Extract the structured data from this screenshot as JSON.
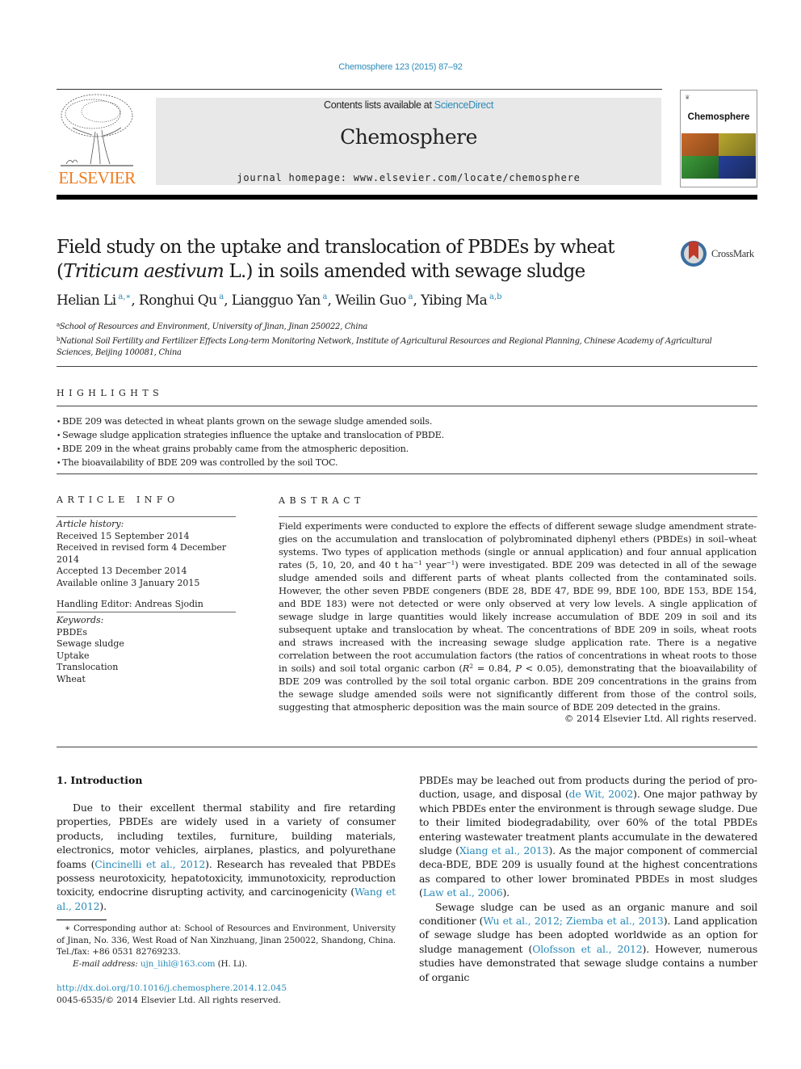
{
  "header": {
    "citation": "Chemosphere 123 (2015) 87–92",
    "publisher_logo_text": "ELSEVIER",
    "contents_prefix": "Contents lists available at ",
    "contents_link": "ScienceDirect",
    "journal_name": "Chemosphere",
    "homepage_prefix": "journal homepage: ",
    "homepage_url": "www.elsevier.com/locate/chemosphere",
    "cover_title": "Chemosphere",
    "cover_mini_logo": "❦"
  },
  "article": {
    "title_part1": "Field study on the uptake and translocation of PBDEs by wheat (",
    "title_italic1": "Triticum aestivum",
    "title_part2": " L.) in soils amended with sewage sludge",
    "crossmark_label": "CrossMark",
    "authors": [
      {
        "name": "Helian Li",
        "sup": "a,∗",
        "sep": ", "
      },
      {
        "name": "Ronghui Qu",
        "sup": "a",
        "sep": ", "
      },
      {
        "name": "Liangguo Yan",
        "sup": "a",
        "sep": ", "
      },
      {
        "name": "Weilin Guo",
        "sup": "a",
        "sep": ", "
      },
      {
        "name": "Yibing Ma",
        "sup": "a,b",
        "sep": ""
      }
    ],
    "affiliations": [
      {
        "mark": "a",
        "text": "School of Resources and Environment, University of Jinan, Jinan 250022, China"
      },
      {
        "mark": "b",
        "text": "National Soil Fertility and Fertilizer Effects Long-term Monitoring Network, Institute of Agricultural Resources and Regional Planning, Chinese Academy of Agricultural Sciences, Beijing 100081, China"
      }
    ]
  },
  "highlights": {
    "heading": "HIGHLIGHTS",
    "items": [
      "BDE 209 was detected in wheat plants grown on the sewage sludge amended soils.",
      "Sewage sludge application strategies influence the uptake and translocation of PBDE.",
      "BDE 209 in the wheat grains probably came from the atmospheric deposition.",
      "The bioavailability of BDE 209 was controlled by the soil TOC."
    ]
  },
  "article_info": {
    "heading": "ARTICLE INFO",
    "history_label": "Article history:",
    "history": [
      "Received 15 September 2014",
      "Received in revised form 4 December 2014",
      "Accepted 13 December 2014",
      "Available online 3 January 2015"
    ],
    "handling_editor": "Handling Editor: Andreas Sjodin",
    "keywords_label": "Keywords:",
    "keywords": [
      "PBDEs",
      "Sewage sludge",
      "Uptake",
      "Translocation",
      "Wheat"
    ]
  },
  "abstract": {
    "heading": "ABSTRACT",
    "text_1": "Field experiments were conducted to explore the effects of different sewage sludge amendment strate­gies on the accumulation and translocation of polybrominated diphenyl ethers (PBDEs) in soil–wheat sys­tems. Two types of application methods (single or annual application) and four annual application rates (5, 10, 20, and 40 t ha",
    "sup_1": "−1",
    "text_2": " year",
    "sup_2": "−1",
    "text_3": ") were investigated. BDE 209 was detected in all of the sewage sludge amended soils and different parts of wheat plants collected from the contaminated soils. However, the other seven PBDE congeners (BDE 28, BDE 47, BDE 99, BDE 100, BDE 153, BDE 154, and BDE 183) were not detected or were only observed at very low levels. A single application of sewage sludge in large quantities would likely increase accumulation of BDE 209 in soil and its subsequent uptake and translo­cation by wheat. The concentrations of BDE 209 in soils, wheat roots and straws increased with the increasing sewage sludge application rate. There is a negative correlation between the root accumulation factors (the ratios of concentrations in wheat roots to those in soils) and soil total organic carbon (",
    "r_symbol": "R",
    "r_sup": "2",
    "text_4": " = 0.84, ",
    "p_symbol": "P",
    "text_5": " < 0.05), demonstrating that the bioavailability of BDE 209 was controlled by the soil total organic carbon. BDE 209 concentrations in the grains from the sewage sludge amended soils were not significantly different from those of the control soils, suggesting that atmospheric deposition was the main source of BDE 209 detected in the grains.",
    "copyright": "© 2014 Elsevier Ltd. All rights reserved."
  },
  "introduction": {
    "heading": "1. Introduction",
    "left_p1": [
      {
        "t": "Due to their excellent thermal stability and fire retarding proper­ties, PBDEs are widely used in a variety of consumer products, including textiles, furniture, building materials, electronics, motor vehicles, airplanes, plastics, and polyurethane foams ("
      },
      {
        "link": "Cincinelli et al., 2012"
      },
      {
        "t": "). Research has revealed that PBDEs possess neurotox­icity, hepatotoxicity, immunotoxicity, reproduction toxicity, endo­crine disrupting activity, and carcinogenicity ("
      },
      {
        "link": "Wang et al., 2012"
      },
      {
        "t": ")."
      }
    ],
    "right_p1": [
      {
        "t": "PBDEs may be leached out from products during the period of pro­duction, usage, and disposal ("
      },
      {
        "link": "de Wit, 2002"
      },
      {
        "t": "). One major pathway by which PBDEs enter the environment is through sewage sludge. Due to their limited biodegradability, over 60% of the total PBDEs entering wastewater treatment plants accumulate in the dewatered sludge ("
      },
      {
        "link": "Xiang et al., 2013"
      },
      {
        "t": "). As the major component of commercial deca-BDE, BDE 209 is usually found at the highest concentrations as compared to other lower brominated PBDEs in most sludges ("
      },
      {
        "link": "Law et al., 2006"
      },
      {
        "t": ")."
      }
    ],
    "right_p2": [
      {
        "t": "Sewage sludge can be used as an organic manure and soil condi­tioner ("
      },
      {
        "link": "Wu et al., 2012; Ziemba et al., 2013"
      },
      {
        "t": "). Land application of sew­age sludge has been adopted worldwide as an option for sludge management ("
      },
      {
        "link": "Olofsson et al., 2012"
      },
      {
        "t": "). However, numerous studies have demonstrated that sewage sludge contains a number of organic"
      }
    ]
  },
  "footnote": {
    "star": "∗",
    "text": " Corresponding author at: School of Resources and Environment, University of Jinan, No. 336, West Road of Nan Xinzhuang, Jinan 250022, Shandong, China. Tel./fax: +86 0531 82769233.",
    "email_label": "E-mail address: ",
    "email": "ujn_lihl@163.com",
    "email_suffix": " (H. Li)."
  },
  "doi": {
    "url": "http://dx.doi.org/10.1016/j.chemosphere.2014.12.045",
    "issn_line": "0045-6535/© 2014 Elsevier Ltd. All rights reserved."
  }
}
